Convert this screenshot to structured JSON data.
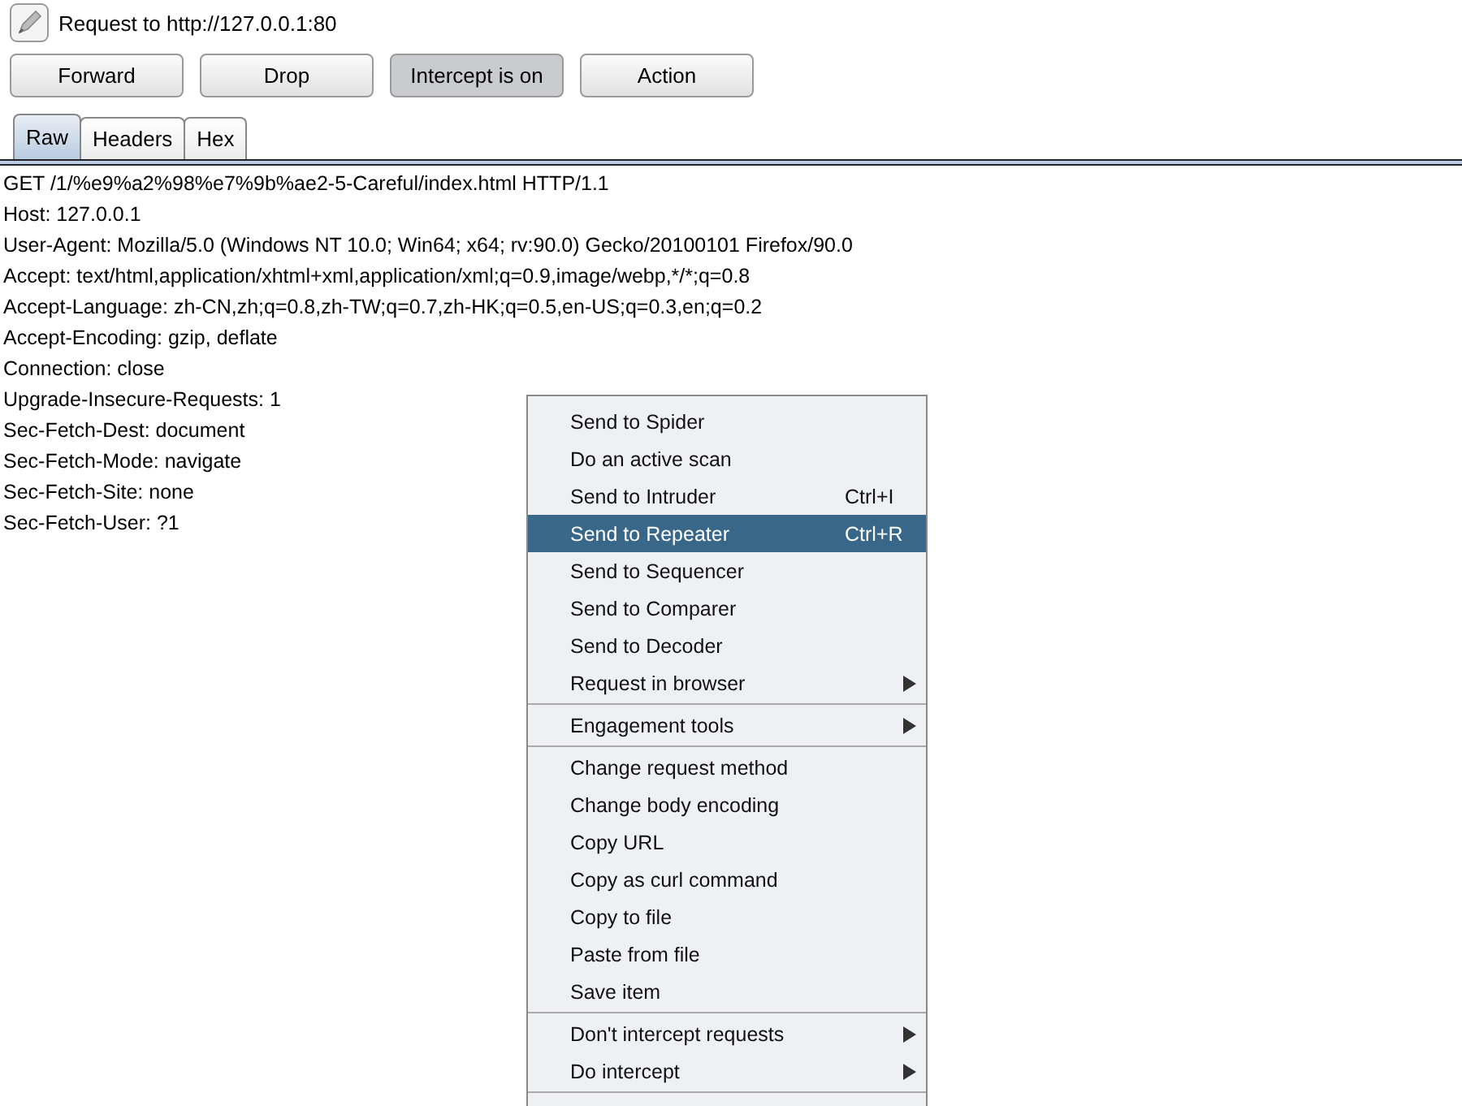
{
  "window": {
    "title": "Request to http://127.0.0.1:80"
  },
  "buttons": [
    {
      "label": "Forward",
      "on": false
    },
    {
      "label": "Drop",
      "on": false
    },
    {
      "label": "Intercept is on",
      "on": true
    },
    {
      "label": "Action",
      "on": false
    }
  ],
  "tabs": [
    {
      "label": "Raw",
      "selected": true
    },
    {
      "label": "Headers",
      "selected": false
    },
    {
      "label": "Hex",
      "selected": false
    }
  ],
  "request_lines": [
    "GET /1/%e9%a2%98%e7%9b%ae2-5-Careful/index.html HTTP/1.1",
    "Host: 127.0.0.1",
    "User-Agent: Mozilla/5.0 (Windows NT 10.0; Win64; x64; rv:90.0) Gecko/20100101 Firefox/90.0",
    "Accept: text/html,application/xhtml+xml,application/xml;q=0.9,image/webp,*/*;q=0.8",
    "Accept-Language: zh-CN,zh;q=0.8,zh-TW;q=0.7,zh-HK;q=0.5,en-US;q=0.3,en;q=0.2",
    "Accept-Encoding: gzip, deflate",
    "Connection: close",
    "Upgrade-Insecure-Requests: 1",
    "Sec-Fetch-Dest: document",
    "Sec-Fetch-Mode: navigate",
    "Sec-Fetch-Site: none",
    "Sec-Fetch-User: ?1"
  ],
  "context_menu": {
    "groups": [
      [
        {
          "label": "Send to Spider",
          "selected": false,
          "submenu": false,
          "disabled": false
        },
        {
          "label": "Do an active scan",
          "selected": false,
          "submenu": false,
          "disabled": false
        },
        {
          "label": "Send to Intruder",
          "shortcut": "Ctrl+I",
          "selected": false,
          "submenu": false,
          "disabled": false
        },
        {
          "label": "Send to Repeater",
          "shortcut": "Ctrl+R",
          "selected": true,
          "submenu": false,
          "disabled": false
        },
        {
          "label": "Send to Sequencer",
          "selected": false,
          "submenu": false,
          "disabled": false
        },
        {
          "label": "Send to Comparer",
          "selected": false,
          "submenu": false,
          "disabled": false
        },
        {
          "label": "Send to Decoder",
          "selected": false,
          "submenu": false,
          "disabled": false
        },
        {
          "label": "Request in browser",
          "selected": false,
          "submenu": true,
          "disabled": false
        }
      ],
      [
        {
          "label": "Engagement tools",
          "selected": false,
          "submenu": true,
          "disabled": false
        }
      ],
      [
        {
          "label": "Change request method",
          "selected": false,
          "submenu": false,
          "disabled": false
        },
        {
          "label": "Change body encoding",
          "selected": false,
          "submenu": false,
          "disabled": false
        },
        {
          "label": "Copy URL",
          "selected": false,
          "submenu": false,
          "disabled": false
        },
        {
          "label": "Copy as curl command",
          "selected": false,
          "submenu": false,
          "disabled": false
        },
        {
          "label": "Copy to file",
          "selected": false,
          "submenu": false,
          "disabled": false
        },
        {
          "label": "Paste from file",
          "selected": false,
          "submenu": false,
          "disabled": false
        },
        {
          "label": "Save item",
          "selected": false,
          "submenu": false,
          "disabled": false
        }
      ],
      [
        {
          "label": "Don't intercept requests",
          "selected": false,
          "submenu": true,
          "disabled": false
        },
        {
          "label": "Do intercept",
          "selected": false,
          "submenu": true,
          "disabled": false
        }
      ]
    ]
  }
}
